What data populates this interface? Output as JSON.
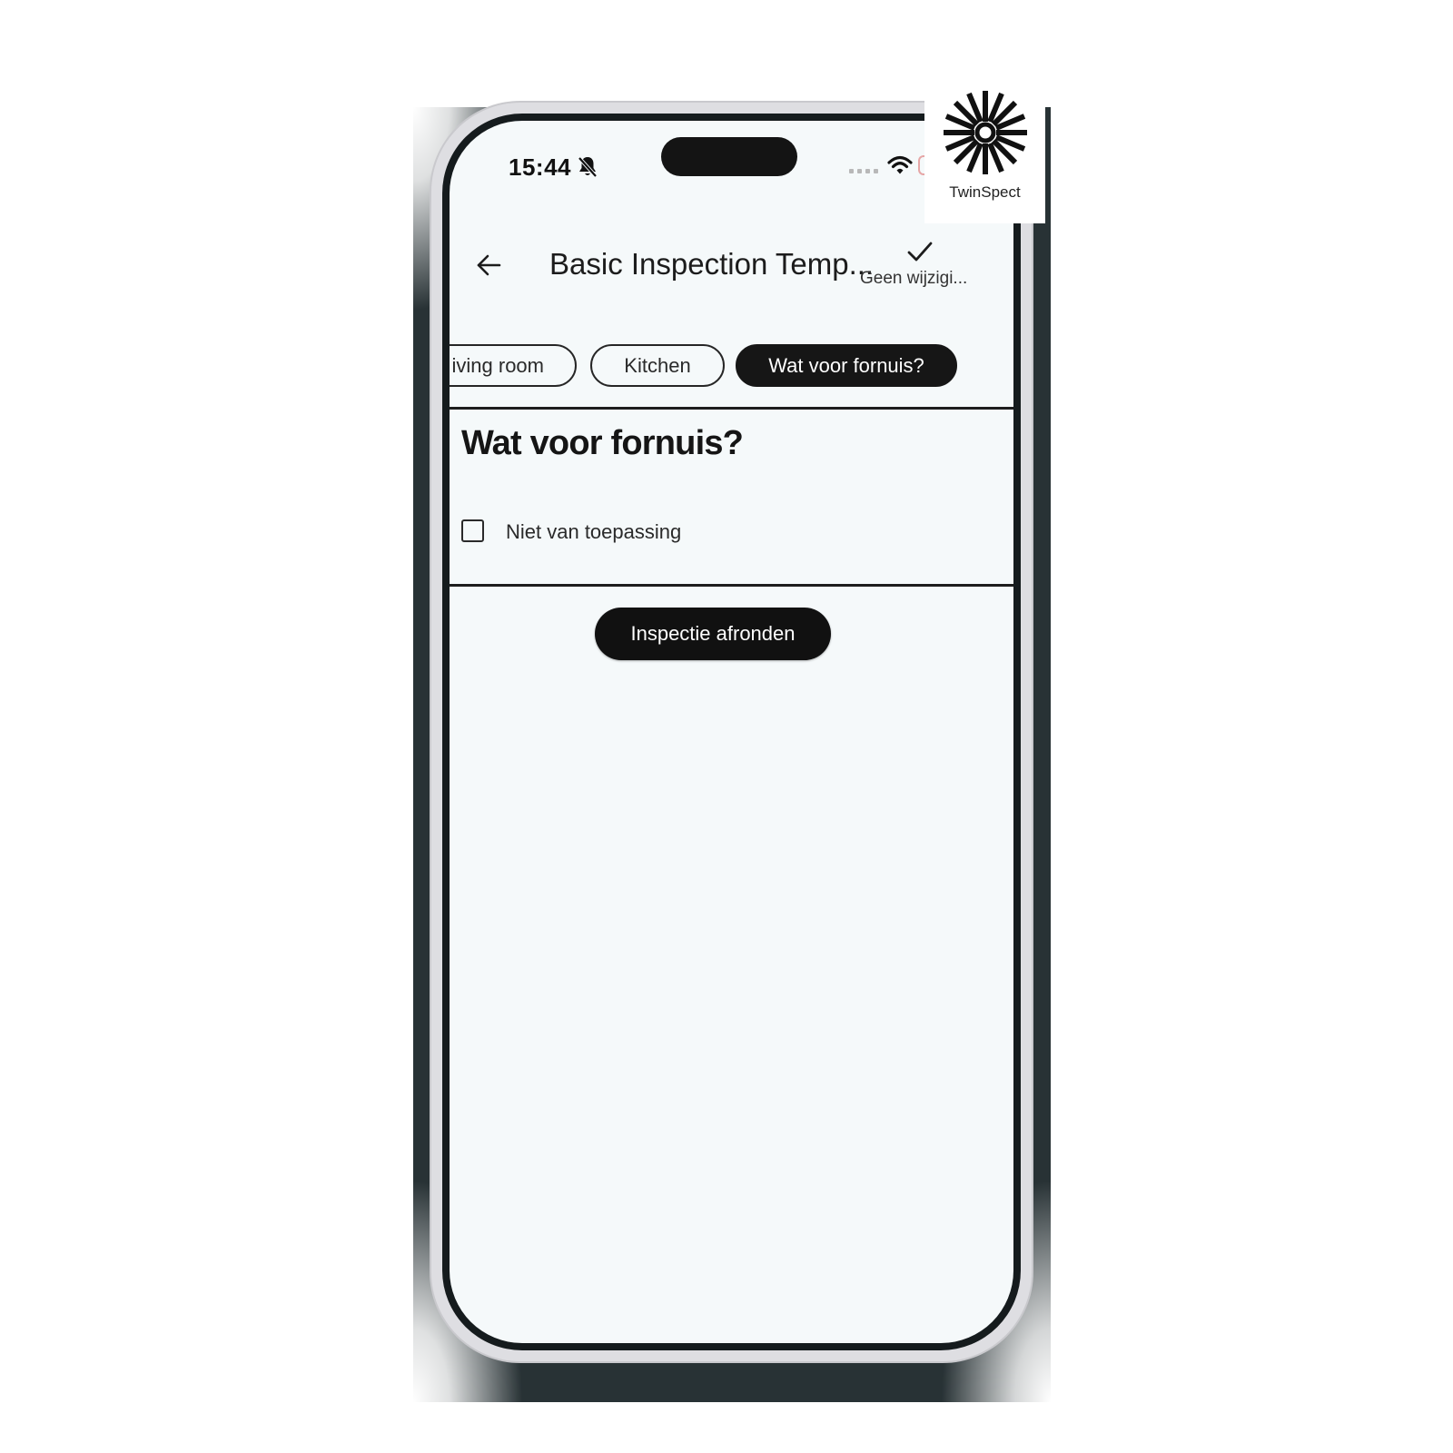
{
  "status_bar": {
    "time": "15:44",
    "icons": [
      "bell-slash-icon",
      "signal-icon",
      "wifi-icon",
      "battery-icon"
    ]
  },
  "header": {
    "back_icon": "arrow-left-icon",
    "title": "Basic Inspection Temp...",
    "save_icon": "check-icon",
    "save_status": "Geen wijzigi..."
  },
  "chips": [
    {
      "label": "Living room",
      "visible_label": "iving room",
      "active": false
    },
    {
      "label": "Kitchen",
      "active": false
    },
    {
      "label": "Wat voor fornuis?",
      "active": true
    }
  ],
  "question": {
    "title": "Wat voor fornuis?",
    "options": [
      {
        "label": "Niet van toepassing",
        "checked": false
      }
    ]
  },
  "actions": {
    "finish_label": "Inspectie afronden"
  },
  "brand": {
    "name": "TwinSpect",
    "icon": "sunburst-logo-icon"
  },
  "colors": {
    "accent": "#161616",
    "screen_background": "#f5f9fa",
    "phone_frame": "#dedee2"
  }
}
